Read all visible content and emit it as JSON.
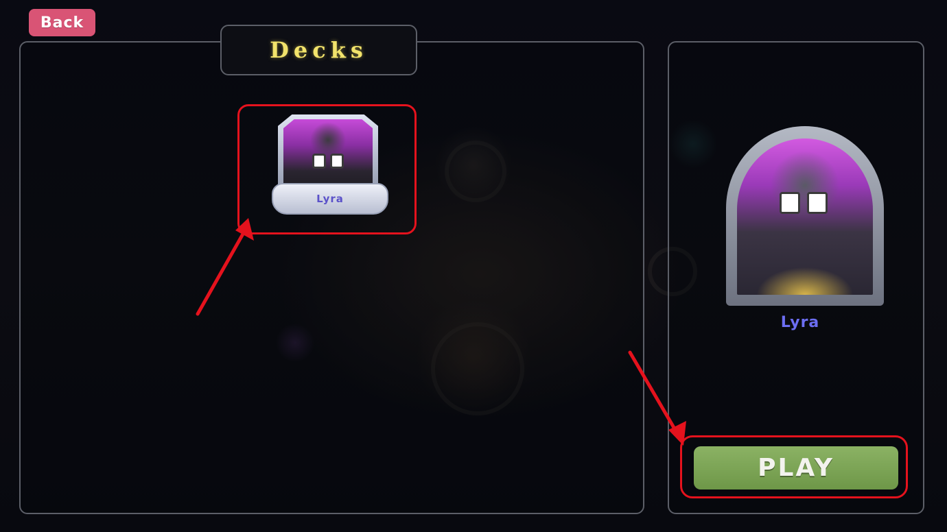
{
  "nav": {
    "back_label": "Back"
  },
  "decks": {
    "title": "Decks",
    "items": [
      {
        "name": "Lyra",
        "selected": true
      }
    ]
  },
  "selected_hero": {
    "name": "Lyra"
  },
  "actions": {
    "play_label": "PLAY"
  },
  "colors": {
    "back_button": "#d95475",
    "title_text": "#f2e36b",
    "hero_name_text": "#6c6ef2",
    "play_button": "#7aa453",
    "annotation_red": "#e5121d",
    "panel_border": "#5c5f68"
  },
  "icons": [
    "hero-portrait-icon",
    "hero-frame-icon"
  ]
}
